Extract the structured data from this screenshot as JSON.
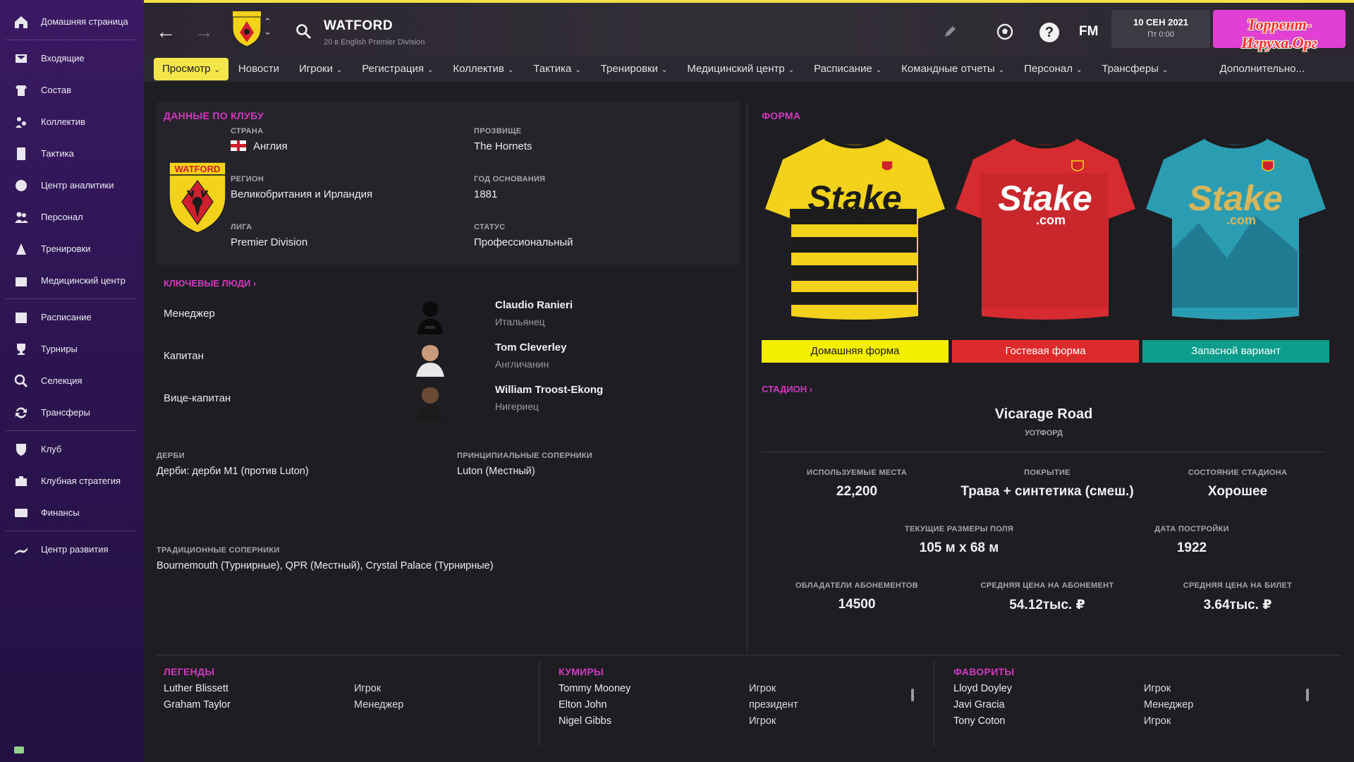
{
  "sidebar": {
    "items": [
      {
        "label": "Домашняя страница",
        "icon": "home-icon"
      },
      {
        "label": "Входящие",
        "icon": "inbox-icon"
      },
      {
        "label": "Состав",
        "icon": "squad-icon"
      },
      {
        "label": "Коллектив",
        "icon": "dynamics-icon"
      },
      {
        "label": "Тактика",
        "icon": "tactics-icon"
      },
      {
        "label": "Центр аналитики",
        "icon": "analytics-icon"
      },
      {
        "label": "Персонал",
        "icon": "staff-icon"
      },
      {
        "label": "Тренировки",
        "icon": "training-icon"
      },
      {
        "label": "Медицинский центр",
        "icon": "medical-icon"
      },
      {
        "label": "Расписание",
        "icon": "calendar-icon"
      },
      {
        "label": "Турниры",
        "icon": "trophy-icon"
      },
      {
        "label": "Селекция",
        "icon": "scouting-icon"
      },
      {
        "label": "Трансферы",
        "icon": "transfers-icon"
      },
      {
        "label": "Клуб",
        "icon": "club-icon"
      },
      {
        "label": "Клубная стратегия",
        "icon": "strategy-icon"
      },
      {
        "label": "Финансы",
        "icon": "finance-icon"
      },
      {
        "label": "Центр развития",
        "icon": "development-icon"
      }
    ]
  },
  "header": {
    "title": "WATFORD",
    "subtitle": "20 в English Premier Division",
    "date": "10 СЕН 2021",
    "day_time": "Пт 0:00",
    "fm_logo": "FM",
    "help": "?",
    "watermark": "Торрент-Игруха.Орг"
  },
  "tabs": [
    {
      "label": "Просмотр",
      "dropdown": true,
      "active": true
    },
    {
      "label": "Новости",
      "dropdown": false
    },
    {
      "label": "Игроки",
      "dropdown": true
    },
    {
      "label": "Регистрация",
      "dropdown": true
    },
    {
      "label": "Коллектив",
      "dropdown": true
    },
    {
      "label": "Тактика",
      "dropdown": true
    },
    {
      "label": "Тренировки",
      "dropdown": true
    },
    {
      "label": "Медицинский центр",
      "dropdown": true
    },
    {
      "label": "Расписание",
      "dropdown": true
    },
    {
      "label": "Командные отчеты",
      "dropdown": true
    },
    {
      "label": "Персонал",
      "dropdown": true
    },
    {
      "label": "Трансферы",
      "dropdown": true
    }
  ],
  "tab_more": "Дополнительно...",
  "club_data": {
    "title": "ДАННЫЕ ПО КЛУБУ",
    "country_label": "СТРАНА",
    "country": "Англия",
    "nickname_label": "ПРОЗВИЩЕ",
    "nickname": "The Hornets",
    "region_label": "РЕГИОН",
    "region": "Великобритания и Ирландия",
    "founded_label": "ГОД ОСНОВАНИЯ",
    "founded": "1881",
    "league_label": "ЛИГА",
    "league": "Premier Division",
    "status_label": "СТАТУС",
    "status": "Профессиональный",
    "badge_text": "WATFORD"
  },
  "key_people": {
    "title": "КЛЮЧЕВЫЕ ЛЮДИ",
    "people": [
      {
        "role": "Менеджер",
        "name": "Claudio Ranieri",
        "nationality": "Итальянец"
      },
      {
        "role": "Капитан",
        "name": "Tom Cleverley",
        "nationality": "Англичанин"
      },
      {
        "role": "Вице-капитан",
        "name": "William Troost-Ekong",
        "nationality": "Нигериец"
      }
    ]
  },
  "rivals": {
    "derby_label": "ДЕРБИ",
    "derby": "Дерби: дерби М1 (против Luton)",
    "principal_label": "ПРИНЦИПИАЛЬНЫЕ СОПЕРНИКИ",
    "principal": "Luton (Местный)",
    "traditional_label": "ТРАДИЦИОННЫЕ СОПЕРНИКИ",
    "traditional": "Bournemouth (Турнирные), QPR (Местный), Crystal Palace (Турнирные)"
  },
  "kits": {
    "title": "ФОРМА",
    "items": [
      {
        "label": "Домашняя форма",
        "color": "#f4ee00",
        "text_color": "#1a1a1a",
        "shirt": "#f2d21a",
        "stripe": "#1c1c1c",
        "sponsor_color": "#1c1c1c"
      },
      {
        "label": "Гостевая форма",
        "color": "#de2a2a",
        "text_color": "#ffffff",
        "shirt": "#d62b30",
        "stripe": "#a81d22",
        "sponsor_color": "#ffffff"
      },
      {
        "label": "Запасной вариант",
        "color": "#0c9d8c",
        "text_color": "#ffffff",
        "shirt": "#2b9db3",
        "stripe": "#1d6e86",
        "sponsor_color": "#d8b65a"
      }
    ],
    "sponsor": "Stake",
    "sponsor_sub": ".com"
  },
  "stadium": {
    "link": "СТАДИОН",
    "name": "Vicarage Road",
    "city": "УОТФОРД",
    "stats": [
      {
        "label": "ИСПОЛЬЗУЕМЫЕ МЕСТА",
        "value": "22,200"
      },
      {
        "label": "ПОКРЫТИЕ",
        "value": "Трава + синтетика (смеш.)"
      },
      {
        "label": "СОСТОЯНИЕ СТАДИОНА",
        "value": "Хорошее"
      },
      {
        "label": "ТЕКУЩИЕ РАЗМЕРЫ ПОЛЯ",
        "value": "105 м x 68 м"
      },
      {
        "label": "ДАТА ПОСТРОЙКИ",
        "value": "1922"
      },
      {
        "label": "ОБЛАДАТЕЛИ АБОНЕМЕНТОВ",
        "value": "14500"
      },
      {
        "label": "СРЕДНЯЯ ЦЕНА НА АБОНЕМЕНТ",
        "value": "54.12тыс. ₽"
      },
      {
        "label": "СРЕДНЯЯ ЦЕНА НА БИЛЕТ",
        "value": "3.64тыс. ₽"
      }
    ]
  },
  "legends": {
    "title": "ЛЕГЕНДЫ",
    "rows": [
      {
        "name": "Luther Blissett",
        "role": "Игрок"
      },
      {
        "name": "Graham Taylor",
        "role": "Менеджер"
      }
    ]
  },
  "idols": {
    "title": "КУМИРЫ",
    "rows": [
      {
        "name": "Tommy Mooney",
        "role": "Игрок"
      },
      {
        "name": "Elton John",
        "role": "президент"
      },
      {
        "name": "Nigel Gibbs",
        "role": "Игрок"
      }
    ]
  },
  "favourites": {
    "title": "ФАВОРИТЫ",
    "rows": [
      {
        "name": "Lloyd Doyley",
        "role": "Игрок"
      },
      {
        "name": "Javi Gracia",
        "role": "Менеджер"
      },
      {
        "name": "Tony Coton",
        "role": "Игрок"
      }
    ]
  }
}
